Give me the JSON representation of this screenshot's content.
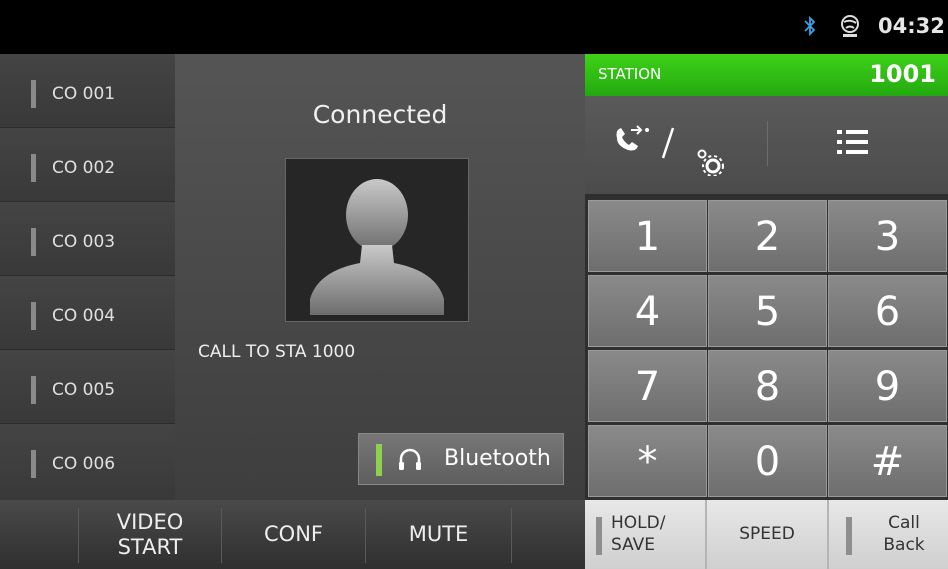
{
  "status_bar": {
    "time": "04:32",
    "bluetooth_icon": "bluetooth-icon",
    "globe_icon": "globe-icon"
  },
  "co_lines": [
    "CO 001",
    "CO 002",
    "CO 003",
    "CO 004",
    "CO 005",
    "CO 006"
  ],
  "call": {
    "status": "Connected",
    "info": "CALL TO STA 1000",
    "audio_button": "Bluetooth"
  },
  "bottom_left": {
    "video_line1": "VIDEO",
    "video_line2": "START",
    "conf": "CONF",
    "mute": "MUTE"
  },
  "station": {
    "label": "STATION",
    "number": "1001",
    "accent_color": "#33c11a"
  },
  "keypad": [
    "1",
    "2",
    "3",
    "4",
    "5",
    "6",
    "7",
    "8",
    "9",
    "*",
    "0",
    "#"
  ],
  "bottom_right": {
    "hold_line1": "HOLD/",
    "hold_line2": "SAVE",
    "speed": "SPEED",
    "callback_line1": "Call",
    "callback_line2": "Back"
  }
}
